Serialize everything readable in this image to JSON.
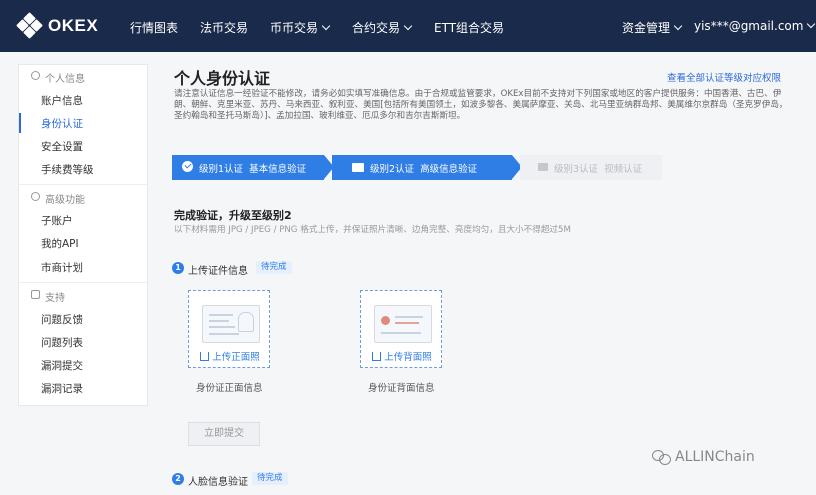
{
  "brand": {
    "logo_text": "OKEX"
  },
  "nav": {
    "items": [
      {
        "label": "行情图表",
        "dropdown": false
      },
      {
        "label": "法币交易",
        "dropdown": false
      },
      {
        "label": "币币交易",
        "dropdown": true
      },
      {
        "label": "合约交易",
        "dropdown": true
      },
      {
        "label": "ETT组合交易",
        "dropdown": false
      }
    ],
    "asset_mgmt": "资金管理",
    "account": "yis***@gmail.com"
  },
  "sidebar": {
    "groups": [
      {
        "label": "个人信息",
        "items": [
          "账户信息",
          "身份认证",
          "安全设置",
          "手续费等级"
        ]
      },
      {
        "label": "高级功能",
        "items": [
          "子账户",
          "我的API",
          "市商计划"
        ]
      },
      {
        "label": "支持",
        "items": [
          "问题反馈",
          "问题列表",
          "漏洞提交",
          "漏洞记录"
        ]
      }
    ],
    "active": "身份认证"
  },
  "main": {
    "title": "个人身份认证",
    "top_link": "查看全部认证等级对应权限",
    "notice": "请注意认证信息一经验证不能修改，请务必如实填写准确信息。由于合规或监管要求，OKEx目前不支持对下列国家或地区的客户提供服务：中国香港、古巴、伊朗、朝鲜、克里米亚、苏丹、马来西亚、叙利亚、美国[包括所有美国领土，如波多黎各、美属萨摩亚、关岛、北马里亚纳群岛邦、美属维尔京群岛（圣克罗伊岛，圣约翰岛和圣托马斯岛）]、孟加拉国、玻利维亚、厄瓜多尔和吉尔吉斯斯坦。",
    "steps": [
      {
        "label": "级别1认证",
        "desc": "基本信息验证",
        "icon": "check-circle-icon",
        "state": "done"
      },
      {
        "label": "级别2认证",
        "desc": "高级信息验证",
        "icon": "id-card-icon",
        "state": "current"
      },
      {
        "label": "级别3认证",
        "desc": "视频认证",
        "icon": "video-icon",
        "state": "pending"
      }
    ],
    "section_title": "完成验证，升级至级别2",
    "section_sub": "以下材料需用 JPG / JPEG / PNG 格式上传，并保证照片清晰、边角完整、亮度均匀，且大小不得超过5M",
    "stage1": {
      "num": "1",
      "label": "上传证件信息",
      "badge": "待完成"
    },
    "uploads": [
      {
        "button": "上传正面照",
        "caption": "身份证正面信息"
      },
      {
        "button": "上传背面照",
        "caption": "身份证背面信息"
      }
    ],
    "submit": "立即提交",
    "stage2": {
      "num": "2",
      "label": "人脸信息验证",
      "badge": "待完成"
    }
  },
  "watermark": {
    "text": "ALLINChain"
  },
  "colors": {
    "nav_bg": "#1a2a4a",
    "accent": "#2f7ee6",
    "link": "#2a6ad9"
  }
}
